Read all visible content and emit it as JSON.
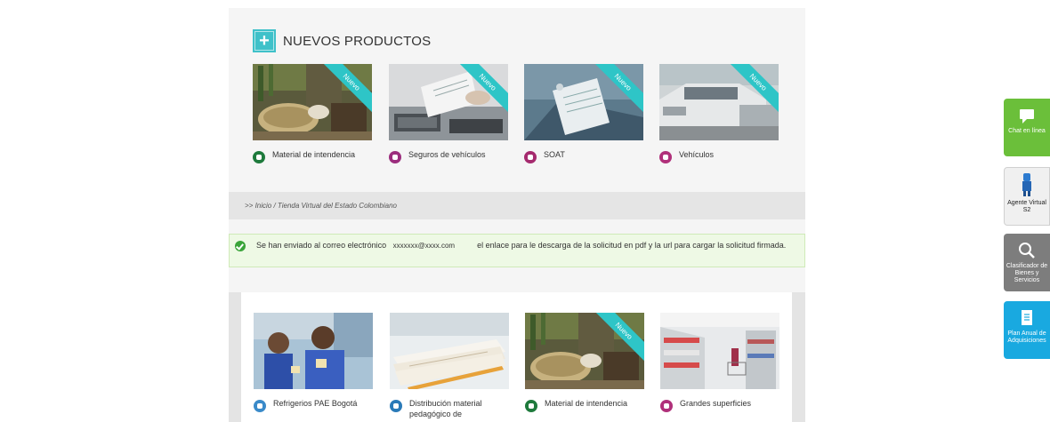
{
  "new_products": {
    "title": "NUEVOS PRODUCTOS",
    "ribbon": "Nuevo",
    "items": [
      {
        "label": "Material de intendencia",
        "icon": "military-icon",
        "icon_color": "#1e7a3c"
      },
      {
        "label": "Seguros de vehículos",
        "icon": "car-insurance-icon",
        "icon_color": "#9b2d7d"
      },
      {
        "label": "SOAT",
        "icon": "soat-icon",
        "icon_color": "#a52a6e"
      },
      {
        "label": "Vehículos",
        "icon": "car-icon",
        "icon_color": "#b0307a"
      }
    ]
  },
  "breadcrumb": {
    "text": ">> Inicio / Tienda Virtual del Estado Colombiano"
  },
  "alert": {
    "part1": "Se han enviado al correo electrónico",
    "email": "xxxxxxx@xxxx.com",
    "part2": "el enlace para le descarga de la solicitud en pdf y la url para cargar la solicitud firmada."
  },
  "catalog": {
    "items": [
      {
        "label": "Refrigerios PAE Bogotá",
        "icon": "food-icon",
        "icon_color": "#3a8ac9"
      },
      {
        "label": "Distribución material pedagógico de",
        "icon": "book-icon",
        "icon_color": "#2a7ab8"
      },
      {
        "label": "Material de intendencia",
        "icon": "military-icon",
        "icon_color": "#1e7a3c"
      },
      {
        "label": "Grandes superficies",
        "icon": "cart-icon",
        "icon_color": "#b0307a"
      }
    ]
  },
  "side_widgets": [
    {
      "label": "Chat en línea",
      "color": "#6bbf3a",
      "icon": "chat-icon"
    },
    {
      "label": "Agente Virtual S2",
      "color": "#f0f0f0",
      "icon": "agent-icon"
    },
    {
      "label": "Clasificador de Bienes y Servicios",
      "color": "#7d7d7d",
      "icon": "search-icon"
    },
    {
      "label": "Plan Anual de Adquisiciones",
      "color": "#19a9e0",
      "icon": "document-icon"
    }
  ]
}
